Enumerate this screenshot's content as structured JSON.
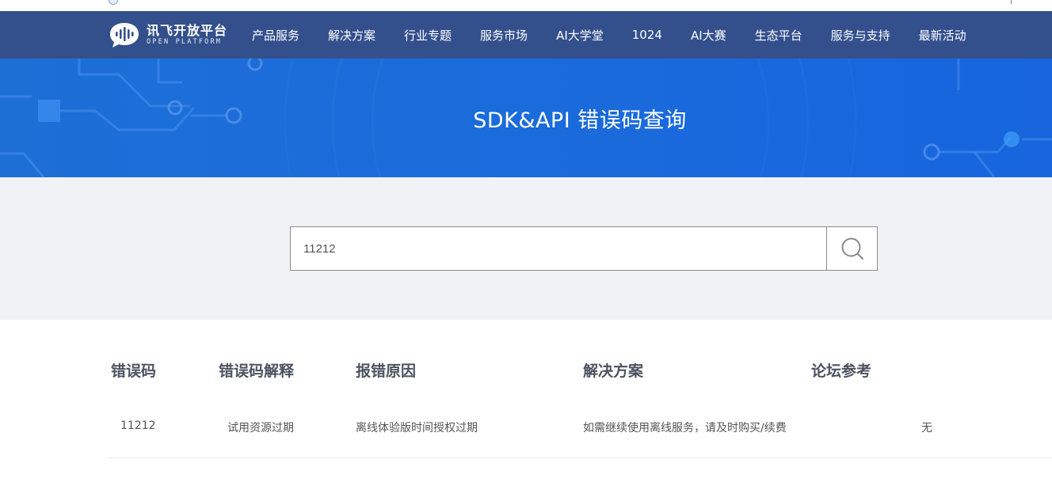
{
  "header": {
    "logo_cn": "讯飞开放平台",
    "logo_en": "OPEN PLATFORM",
    "nav": [
      {
        "label": "产品服务"
      },
      {
        "label": "解决方案"
      },
      {
        "label": "行业专题"
      },
      {
        "label": "服务市场"
      },
      {
        "label": "AI大学堂"
      },
      {
        "label": "1024"
      },
      {
        "label": "AI大赛"
      },
      {
        "label": "生态平台"
      },
      {
        "label": "服务与支持"
      },
      {
        "label": "最新活动"
      }
    ]
  },
  "banner": {
    "title": "SDK&API 错误码查询"
  },
  "search": {
    "value": "11212",
    "icon": "search-icon"
  },
  "table": {
    "headers": [
      "错误码",
      "错误码解释",
      "报错原因",
      "解决方案",
      "论坛参考"
    ],
    "rows": [
      [
        "11212",
        "试用资源过期",
        "离线体验版时间授权过期",
        "如需继续使用离线服务，请及时购买/续费",
        "无"
      ]
    ]
  },
  "colors": {
    "navbar": "#34508c",
    "banner": "#1a6bdc",
    "search_bg": "#f1f2f6"
  }
}
